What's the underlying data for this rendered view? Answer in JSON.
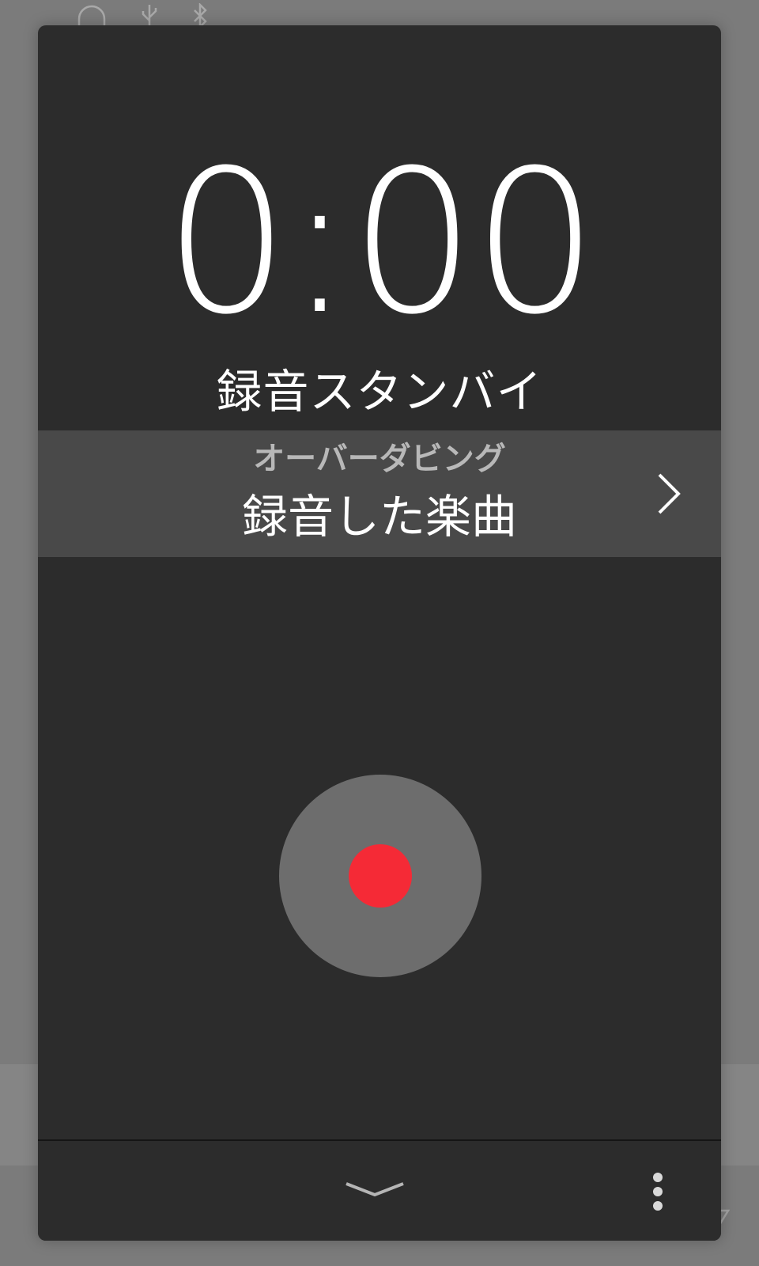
{
  "timer": {
    "value": "0:00"
  },
  "status": {
    "text": "録音スタンバイ"
  },
  "overdub": {
    "label": "オーバーダビング",
    "value": "録音した楽曲"
  },
  "icons": {
    "background": [
      "headphones-icon",
      "usb-icon",
      "bluetooth-icon"
    ],
    "overdub_arrow": "chevron-right-icon",
    "record": "record-icon",
    "collapse": "chevron-down-icon",
    "menu": "more-vertical-icon"
  },
  "colors": {
    "panel": "#2c2c2c",
    "overdub_row": "#494949",
    "record_ring": "#6d6d6d",
    "record_dot": "#f52a36",
    "text_primary": "#ffffff",
    "text_secondary": "#b8b8b8"
  }
}
